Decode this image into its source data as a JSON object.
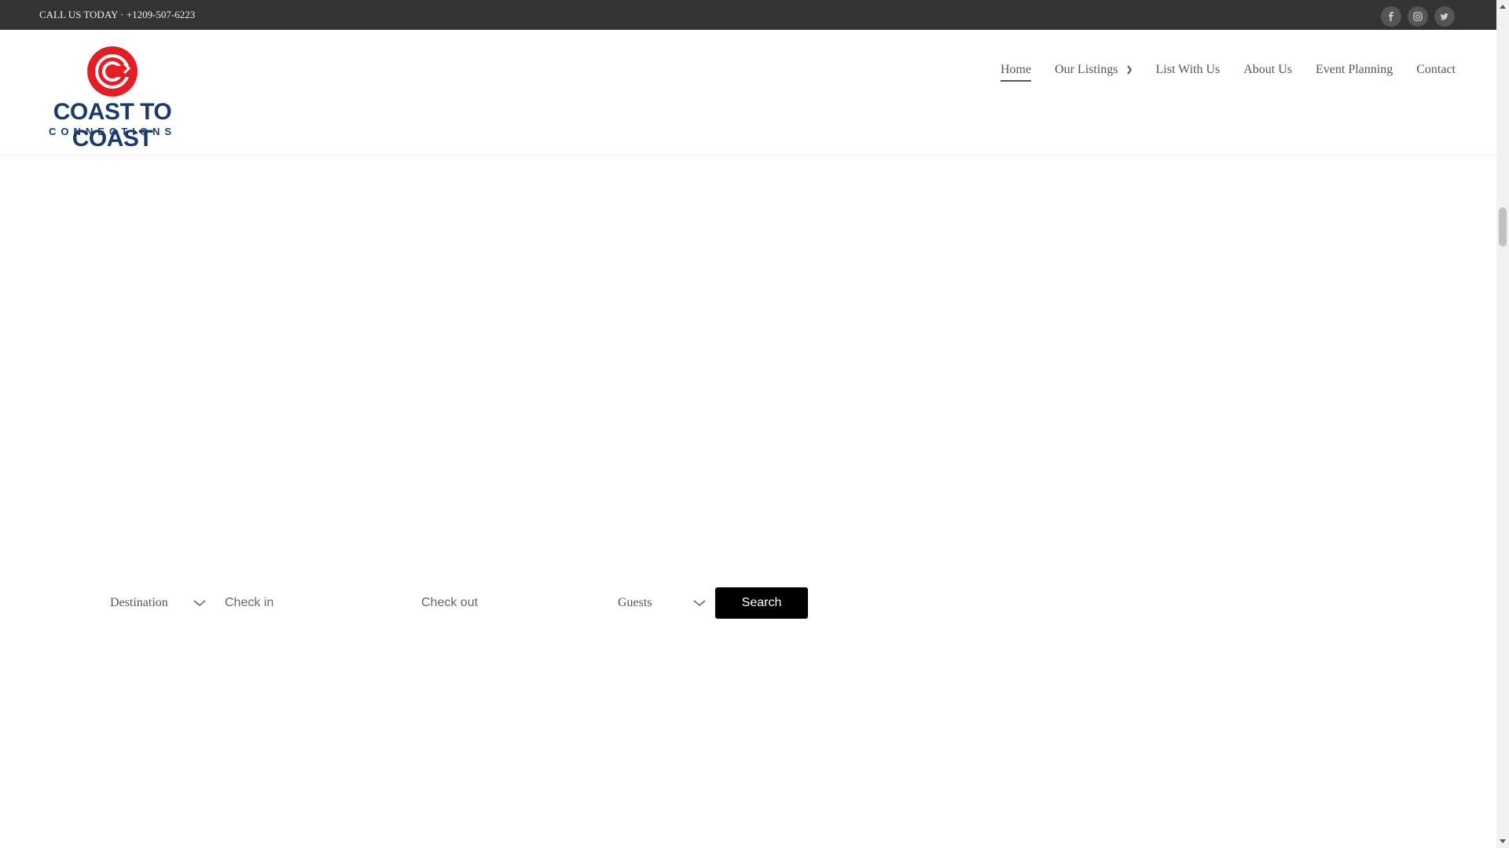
{
  "topbar": {
    "call_text": "CALL US TODAY · +1209-507-6223",
    "social_icons": [
      "facebook-icon",
      "instagram-icon",
      "twitter-icon"
    ]
  },
  "logo": {
    "title": "COAST TO COAST",
    "subtitle": "CONNECTIONS",
    "colors": {
      "red": "#e31e26",
      "navy": "#1b3a6b"
    }
  },
  "nav": {
    "items": [
      {
        "label": "Home",
        "active": true
      },
      {
        "label": "Our Listings",
        "has_dropdown": true
      },
      {
        "label": "List With Us"
      },
      {
        "label": "About Us"
      },
      {
        "label": "Event Planning"
      },
      {
        "label": "Contact"
      }
    ]
  },
  "search": {
    "destination_label": "Destination",
    "checkin_placeholder": "Check in",
    "checkout_placeholder": "Check out",
    "guests_label": "Guests",
    "button_label": "Search"
  },
  "colors": {
    "topbar_bg": "#333333",
    "button_bg": "#000000",
    "text": "#555555"
  }
}
